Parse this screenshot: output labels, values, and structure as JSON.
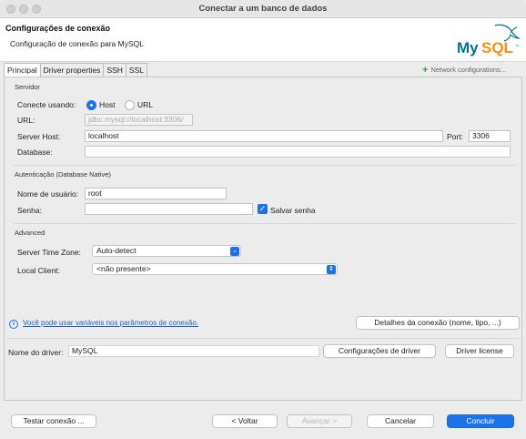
{
  "window": {
    "title": "Conectar a um banco de dados"
  },
  "header": {
    "title": "Configurações de conexão",
    "subtitle": "Configuração de conexão para MySQL",
    "logo_text": "MySQL"
  },
  "tabs": [
    {
      "label": "Principal",
      "active": true
    },
    {
      "label": "Driver properties",
      "active": false
    },
    {
      "label": "SSH",
      "active": false
    },
    {
      "label": "SSL",
      "active": false
    }
  ],
  "network_config": {
    "label": "Network configurations..."
  },
  "servidor": {
    "section_title": "Servidor",
    "connect_using_label": "Conecte usando:",
    "radio_host": "Host",
    "radio_url": "URL",
    "selected": "Host",
    "url_label": "URL:",
    "url_value": "jdbc:mysql://localhost:3306/",
    "server_host_label": "Server Host:",
    "server_host_value": "localhost",
    "port_label": "Port:",
    "port_value": "3306",
    "database_label": "Database:",
    "database_value": ""
  },
  "auth": {
    "section_title": "Autenticação (Database Native)",
    "username_label": "Nome de usuário:",
    "username_value": "root",
    "password_label": "Senha:",
    "password_value": "",
    "save_password_label": "Salvar senha",
    "save_password_checked": true
  },
  "advanced": {
    "section_title": "Advanced",
    "timezone_label": "Server Time Zone:",
    "timezone_value": "Auto-detect",
    "local_client_label": "Local Client:",
    "local_client_value": "<não presente>"
  },
  "info": {
    "link_text": "Você pode usar variáveis nos parâmetros de conexão.",
    "details_button": "Detalhes da conexão (nome, tipo, ...)"
  },
  "driver": {
    "name_label": "Nome do driver:",
    "name_value": "MySQL",
    "settings_button": "Configurações de driver",
    "license_button": "Driver license"
  },
  "footer": {
    "test_button": "Testar conexão ...",
    "back_button": "< Voltar",
    "next_button": "Avançar >",
    "cancel_button": "Cancelar",
    "finish_button": "Concluir"
  },
  "colors": {
    "accent": "#1a73e8",
    "logo_blue": "#00758f",
    "logo_orange": "#f29111"
  }
}
